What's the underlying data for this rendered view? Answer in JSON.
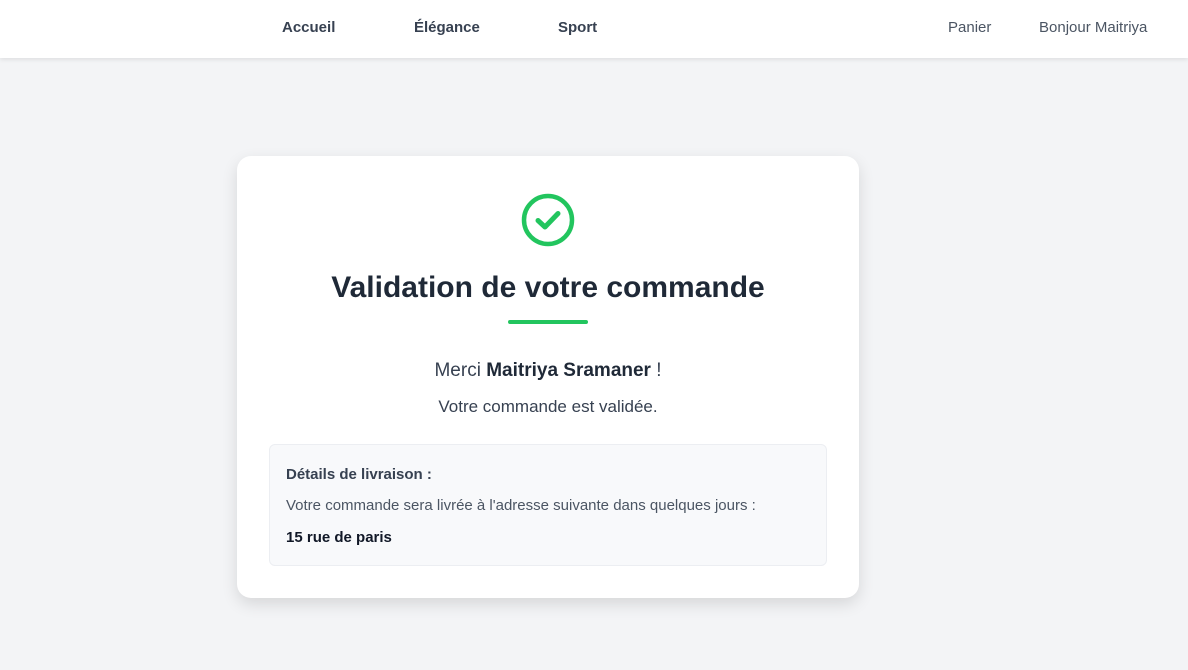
{
  "nav": {
    "home": "Accueil",
    "elegance": "Élégance",
    "sport": "Sport",
    "cart": "Panier",
    "greeting": "Bonjour Maitriya"
  },
  "confirmation": {
    "icon": "check-circle-icon",
    "title": "Validation de votre commande",
    "thanks_prefix": "Merci",
    "customer_name": "Maitriya Sramaner",
    "thanks_suffix": "!",
    "status_message": "Votre commande est validée."
  },
  "delivery": {
    "heading": "Détails de livraison :",
    "message": "Votre commande sera livrée à l'adresse suivante dans quelques jours :",
    "address": "15 rue de paris"
  },
  "colors": {
    "accent": "#22c55e",
    "background": "#f3f4f6",
    "card": "#ffffff",
    "text": "#1f2937"
  }
}
